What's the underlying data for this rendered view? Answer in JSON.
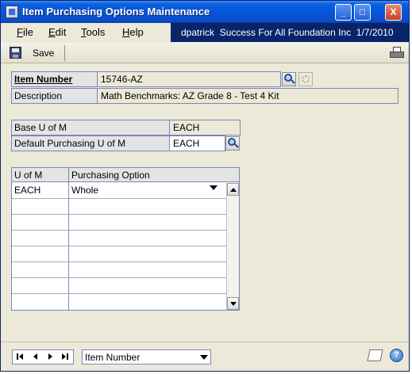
{
  "window": {
    "title": "Item Purchasing Options Maintenance",
    "controls": {
      "minimize": "_",
      "maximize": "□",
      "close": "X"
    }
  },
  "menu": {
    "file_pre": "",
    "file_u": "F",
    "file_post": "ile",
    "edit_pre": "",
    "edit_u": "E",
    "edit_post": "dit",
    "tools_pre": "",
    "tools_u": "T",
    "tools_post": "ools",
    "help_pre": "",
    "help_u": "H",
    "help_post": "elp"
  },
  "session": {
    "user": "dpatrick",
    "company": "Success For All Foundation Inc",
    "date": "1/7/2010",
    "bar_text": "dpatrick   Success For All Foundation Inc  1/7/2010"
  },
  "toolbar": {
    "save_label": "Save",
    "save_icon": "floppy-disk-icon",
    "print_icon": "printer-icon"
  },
  "form": {
    "item_number_label": "Item Number",
    "item_number_value": "15746-AZ",
    "description_label": "Description",
    "description_value": "Math Benchmarks: AZ Grade 8 - Test 4 Kit",
    "base_uom_label": "Base U of M",
    "base_uom_value": "EACH",
    "default_purch_uom_label": "Default Purchasing U of M",
    "default_purch_uom_value": "EACH"
  },
  "grid": {
    "headers": {
      "uom": "U of M",
      "option": "Purchasing Option"
    },
    "rows": [
      {
        "uom": "EACH",
        "option": "Whole"
      },
      {
        "uom": "",
        "option": ""
      },
      {
        "uom": "",
        "option": ""
      },
      {
        "uom": "",
        "option": ""
      },
      {
        "uom": "",
        "option": ""
      },
      {
        "uom": "",
        "option": ""
      },
      {
        "uom": "",
        "option": ""
      },
      {
        "uom": "",
        "option": ""
      }
    ]
  },
  "status": {
    "sort_by": "Item Number",
    "help_glyph": "?"
  },
  "colors": {
    "titlebar": "#0654d6",
    "userbar": "#0a246a",
    "window_bg": "#ece9d8",
    "field_border": "#7a86b8"
  }
}
